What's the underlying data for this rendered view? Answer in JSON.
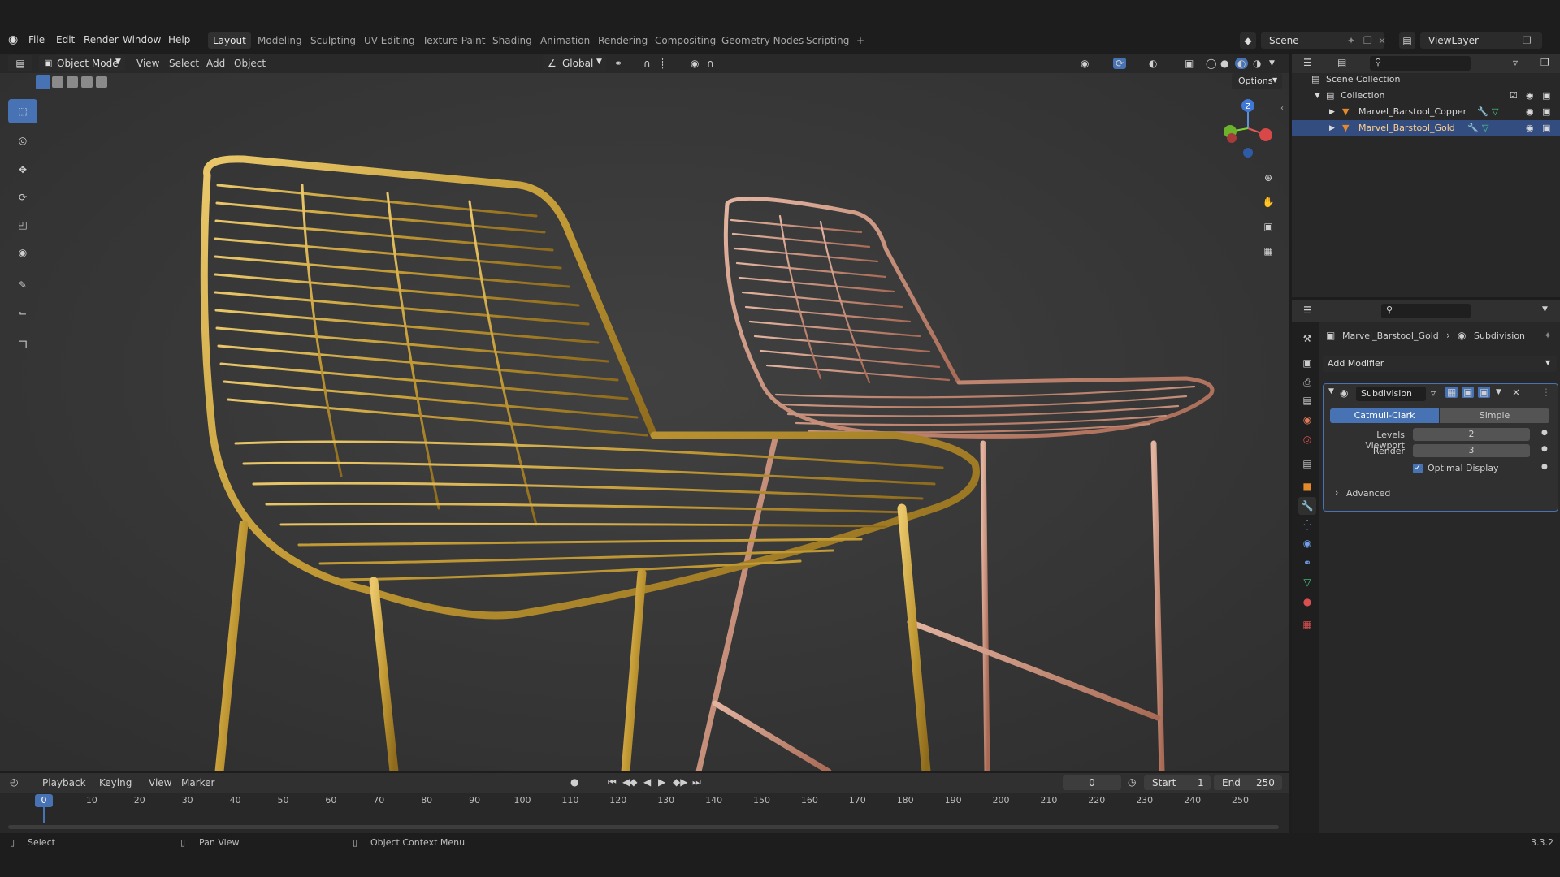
{
  "menu": {
    "items": [
      "File",
      "Edit",
      "Render",
      "Window",
      "Help"
    ],
    "workspaces": [
      "Layout",
      "Modeling",
      "Sculpting",
      "UV Editing",
      "Texture Paint",
      "Shading",
      "Animation",
      "Rendering",
      "Compositing",
      "Geometry Nodes",
      "Scripting"
    ],
    "active_workspace": "Layout",
    "add_tab": "+",
    "scene": "Scene",
    "view_layer": "ViewLayer"
  },
  "viewport": {
    "mode": "Object Mode",
    "menus": [
      "View",
      "Select",
      "Add",
      "Object"
    ],
    "transform_orientation": "Global",
    "options": "Options",
    "gizmo_axis": "Z"
  },
  "outliner": {
    "scene_collection": "Scene Collection",
    "collection": "Collection",
    "objects": [
      {
        "name": "Marvel_Barstool_Copper",
        "selected": false
      },
      {
        "name": "Marvel_Barstool_Gold",
        "selected": true
      }
    ]
  },
  "properties": {
    "object_name": "Marvel_Barstool_Gold",
    "modifier_crumb": "Subdivision",
    "add_modifier": "Add Modifier",
    "modifier": {
      "name": "Subdivision",
      "type_options": [
        "Catmull-Clark",
        "Simple"
      ],
      "active_type": "Catmull-Clark",
      "levels_viewport_label": "Levels Viewport",
      "levels_viewport": "2",
      "render_label": "Render",
      "render": "3",
      "optimal_display_label": "Optimal Display",
      "optimal_display": true,
      "advanced_label": "Advanced"
    }
  },
  "timeline": {
    "menus": [
      "Playback",
      "Keying",
      "View",
      "Marker"
    ],
    "current_frame": "0",
    "start_label": "Start",
    "start": "1",
    "end_label": "End",
    "end": "250",
    "ticks": [
      "0",
      "10",
      "20",
      "30",
      "40",
      "50",
      "60",
      "70",
      "80",
      "90",
      "100",
      "110",
      "120",
      "130",
      "140",
      "150",
      "160",
      "170",
      "180",
      "190",
      "200",
      "210",
      "220",
      "230",
      "240",
      "250"
    ]
  },
  "status": {
    "select": "Select",
    "pan_view": "Pan View",
    "context_menu": "Object Context Menu",
    "version": "3.3.2"
  },
  "colors": {
    "accent": "#4772b3",
    "gold": "#c9a23a",
    "copper": "#c98a72",
    "bg_viewport": "#3a3a3a"
  }
}
